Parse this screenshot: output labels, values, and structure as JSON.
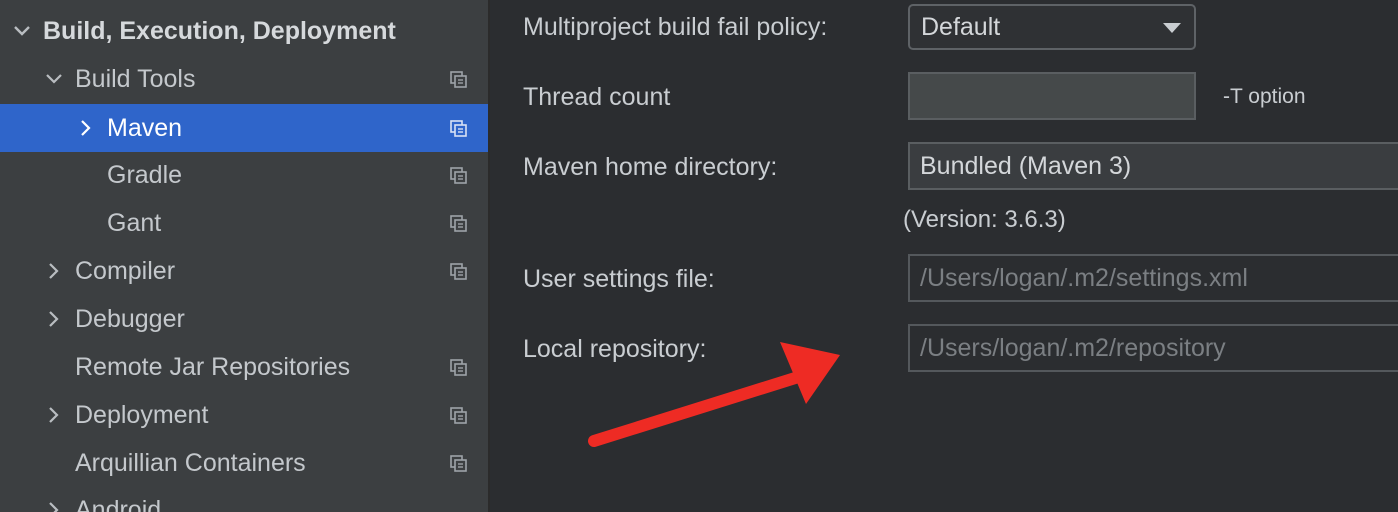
{
  "sidebar": {
    "items": [
      {
        "label": "Build, Execution, Deployment",
        "expander": "expanded",
        "copy": false
      },
      {
        "label": "Build Tools",
        "expander": "expanded",
        "copy": true
      },
      {
        "label": "Maven",
        "expander": "collapsed",
        "copy": true,
        "selected": true
      },
      {
        "label": "Gradle",
        "expander": "none",
        "copy": true
      },
      {
        "label": "Gant",
        "expander": "none",
        "copy": true
      },
      {
        "label": "Compiler",
        "expander": "collapsed",
        "copy": true
      },
      {
        "label": "Debugger",
        "expander": "collapsed",
        "copy": false
      },
      {
        "label": "Remote Jar Repositories",
        "expander": "none",
        "copy": true
      },
      {
        "label": "Deployment",
        "expander": "collapsed",
        "copy": true
      },
      {
        "label": "Arquillian Containers",
        "expander": "none",
        "copy": true
      },
      {
        "label": "Android",
        "expander": "collapsed",
        "copy": false
      }
    ]
  },
  "form": {
    "fail_policy_label": "Multiproject build fail policy:",
    "fail_policy_value": "Default",
    "thread_count_label": "Thread count",
    "thread_count_value": "",
    "thread_count_hint": "-T option",
    "maven_home_label": "Maven home directory:",
    "maven_home_value": "Bundled (Maven 3)",
    "maven_version": "(Version: 3.6.3)",
    "user_settings_label": "User settings file:",
    "user_settings_placeholder": "/Users/logan/.m2/settings.xml",
    "local_repo_label": "Local repository:",
    "local_repo_placeholder": "/Users/logan/.m2/repository"
  },
  "colors": {
    "accent_selection": "#2f65ca",
    "annotation_arrow": "#ee2b24"
  }
}
